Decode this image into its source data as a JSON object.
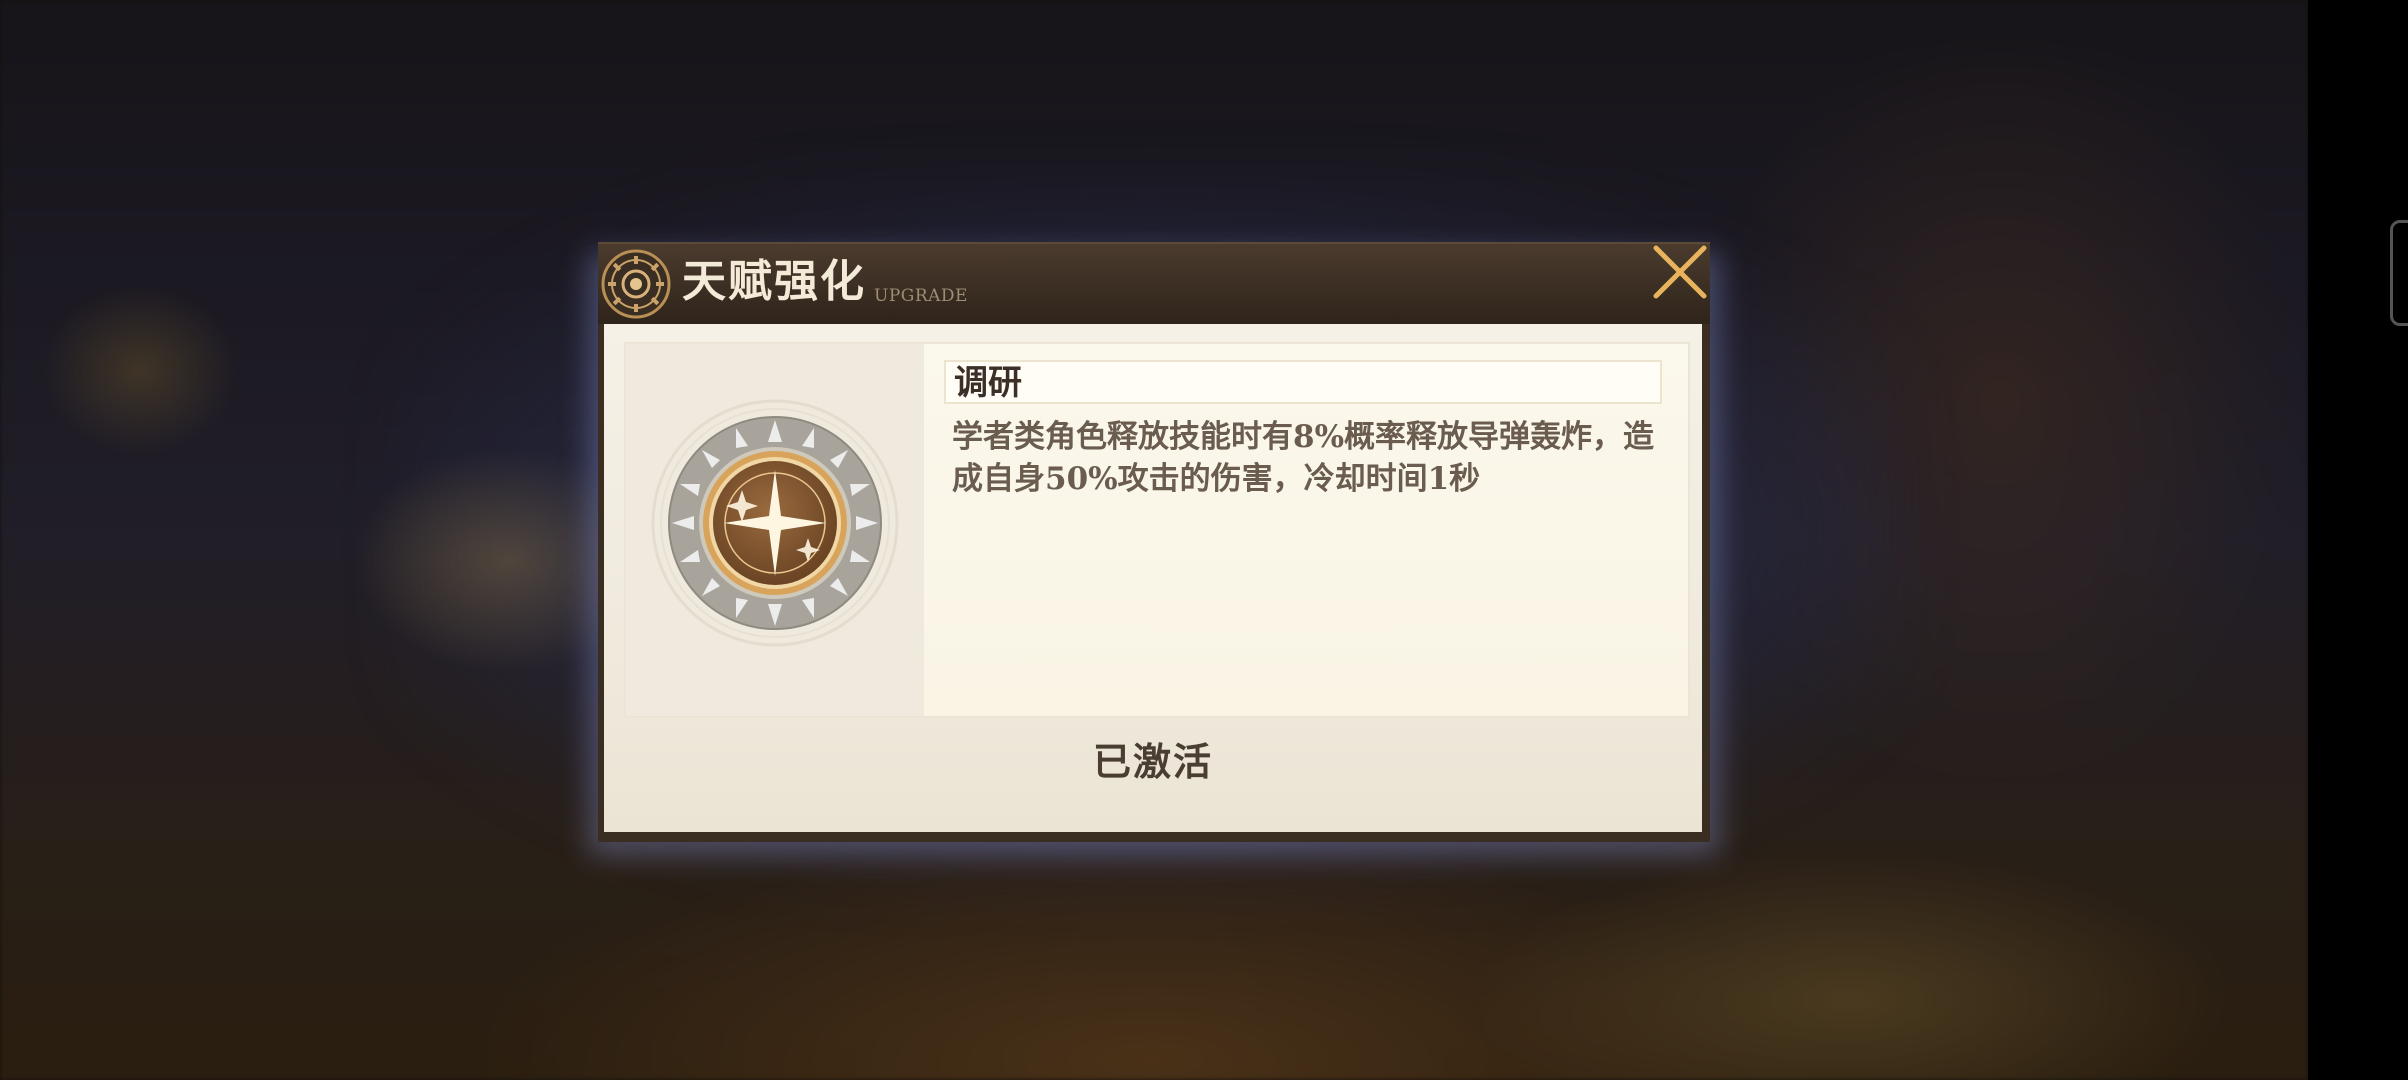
{
  "dialog": {
    "title": "天赋强化",
    "subtitle": "UPGRADE",
    "close_icon": "close-icon",
    "emblem_icon": "talent-emblem-icon"
  },
  "talent": {
    "name": "调研",
    "description": "学者类角色释放技能时有8%概率释放导弹轰炸，造成自身50%攻击的伤害，冷却时间1秒",
    "icon": "sparkle-compass-icon",
    "status": "已激活"
  },
  "colors": {
    "header": "#3a2d22",
    "accent_gold": "#e7b35c",
    "panel": "#f5f1e6"
  }
}
